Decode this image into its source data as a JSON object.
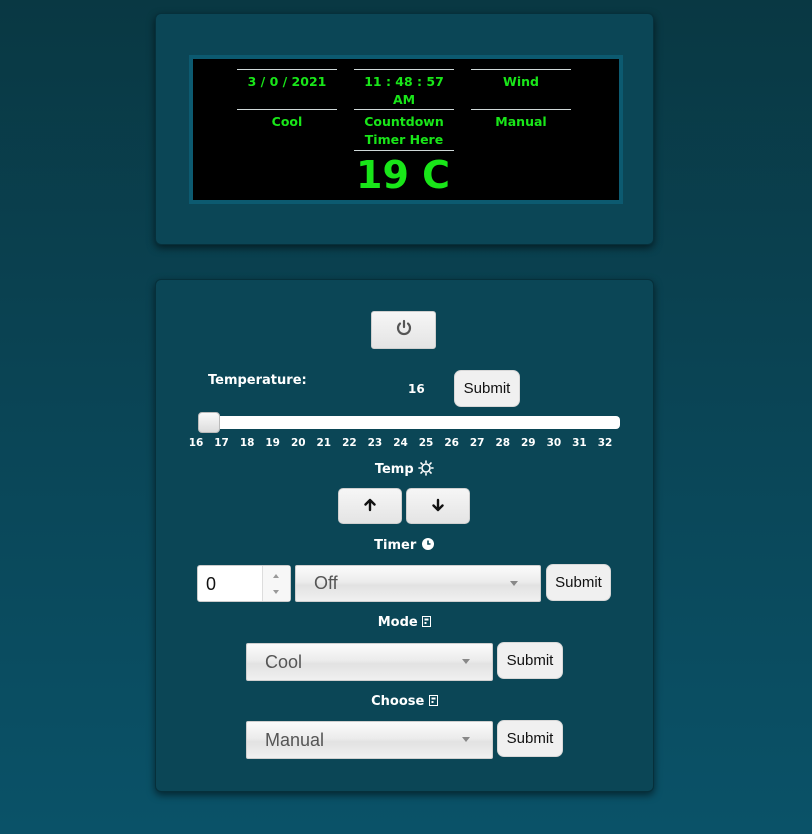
{
  "display": {
    "date": "3 / 0 / 2021",
    "time": "11 : 48 : 57 AM",
    "wind": "Wind",
    "mode": "Cool",
    "countdown": "Countdown\nTimer Here",
    "control_mode": "Manual",
    "temperature": "19 C"
  },
  "controls": {
    "power_icon": "power-icon",
    "temperature_label": "Temperature:",
    "temperature_value": "16",
    "temperature_value_fraction": 0,
    "submit_label": "Submit",
    "slider_ticks": [
      "16",
      "17",
      "18",
      "19",
      "20",
      "21",
      "22",
      "23",
      "24",
      "25",
      "26",
      "27",
      "28",
      "29",
      "30",
      "31",
      "32"
    ],
    "temp_label": "Temp",
    "temp_icon": "sun-icon",
    "up_icon": "arrow-up-icon",
    "down_icon": "arrow-down-icon",
    "timer_label": "Timer",
    "timer_icon": "clock-icon",
    "timer_input_value": "0",
    "timer_select_value": "Off",
    "mode_label": "Mode",
    "mode_icon": "remote-icon",
    "mode_select_value": "Cool",
    "choose_label": "Choose",
    "choose_icon": "remote-icon",
    "choose_select_value": "Manual"
  },
  "colors": {
    "lcd_text": "#19e619",
    "lcd_background": "#000000",
    "card_background": "#0b4656"
  }
}
